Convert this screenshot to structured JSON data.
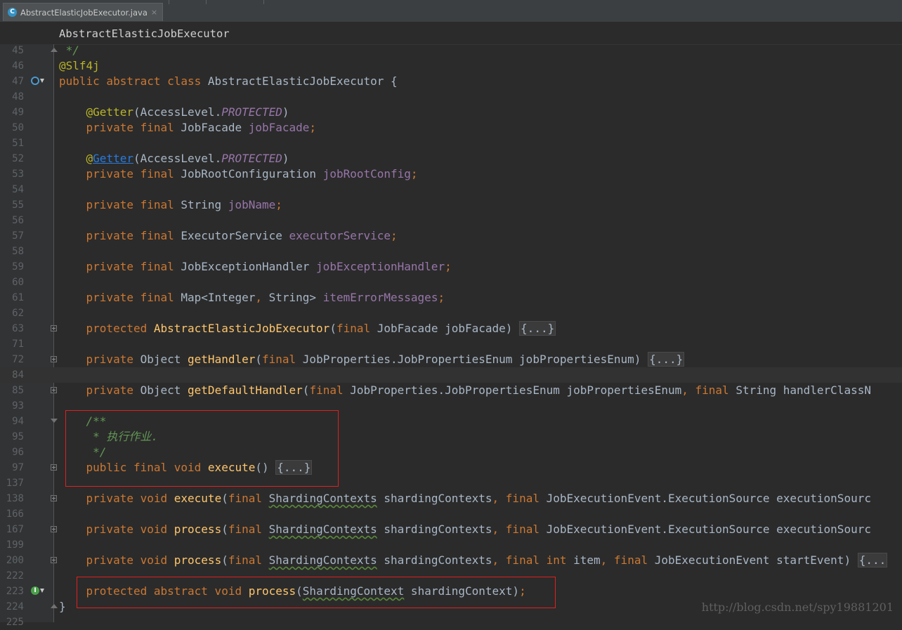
{
  "tab": {
    "icon": "C",
    "label": "AbstractElasticJobExecutor.java",
    "close": "×"
  },
  "breadcrumb": "AbstractElasticJobExecutor",
  "lines": [
    {
      "n": "45",
      "marker": "",
      "fold": "up",
      "segs": [
        {
          "t": " */",
          "c": "doc"
        }
      ]
    },
    {
      "n": "46",
      "marker": "",
      "fold": "",
      "segs": [
        {
          "t": "@Slf4j",
          "c": "ann"
        }
      ]
    },
    {
      "n": "47",
      "marker": "overridden",
      "fold": "",
      "segs": [
        {
          "t": "public abstract class ",
          "c": "kw"
        },
        {
          "t": "AbstractElasticJobExecutor {",
          "c": ""
        }
      ]
    },
    {
      "n": "48",
      "marker": "",
      "fold": "",
      "segs": []
    },
    {
      "n": "49",
      "marker": "",
      "fold": "",
      "segs": [
        {
          "t": "    @Getter",
          "c": "ann"
        },
        {
          "t": "(AccessLevel.",
          "c": ""
        },
        {
          "t": "PROTECTED",
          "c": "ital"
        },
        {
          "t": ")",
          "c": ""
        }
      ]
    },
    {
      "n": "50",
      "marker": "",
      "fold": "",
      "segs": [
        {
          "t": "    private final ",
          "c": "kw"
        },
        {
          "t": "JobFacade ",
          "c": ""
        },
        {
          "t": "jobFacade",
          "c": "fld"
        },
        {
          "t": ";",
          "c": "kw"
        }
      ]
    },
    {
      "n": "51",
      "marker": "",
      "fold": "",
      "segs": []
    },
    {
      "n": "52",
      "marker": "",
      "fold": "",
      "segs": [
        {
          "t": "    @",
          "c": "ann"
        },
        {
          "t": "Getter",
          "c": "link"
        },
        {
          "t": "(AccessLevel.",
          "c": ""
        },
        {
          "t": "PROTECTED",
          "c": "ital"
        },
        {
          "t": ")",
          "c": ""
        }
      ]
    },
    {
      "n": "53",
      "marker": "",
      "fold": "",
      "segs": [
        {
          "t": "    private final ",
          "c": "kw"
        },
        {
          "t": "JobRootConfiguration ",
          "c": ""
        },
        {
          "t": "jobRootConfig",
          "c": "fld"
        },
        {
          "t": ";",
          "c": "kw"
        }
      ]
    },
    {
      "n": "54",
      "marker": "",
      "fold": "",
      "segs": []
    },
    {
      "n": "55",
      "marker": "",
      "fold": "",
      "segs": [
        {
          "t": "    private final ",
          "c": "kw"
        },
        {
          "t": "String ",
          "c": ""
        },
        {
          "t": "jobName",
          "c": "fld"
        },
        {
          "t": ";",
          "c": "kw"
        }
      ]
    },
    {
      "n": "56",
      "marker": "",
      "fold": "",
      "segs": []
    },
    {
      "n": "57",
      "marker": "",
      "fold": "",
      "segs": [
        {
          "t": "    private final ",
          "c": "kw"
        },
        {
          "t": "ExecutorService ",
          "c": ""
        },
        {
          "t": "executorService",
          "c": "fld"
        },
        {
          "t": ";",
          "c": "kw"
        }
      ]
    },
    {
      "n": "58",
      "marker": "",
      "fold": "",
      "segs": []
    },
    {
      "n": "59",
      "marker": "",
      "fold": "",
      "segs": [
        {
          "t": "    private final ",
          "c": "kw"
        },
        {
          "t": "JobExceptionHandler ",
          "c": ""
        },
        {
          "t": "jobExceptionHandler",
          "c": "fld"
        },
        {
          "t": ";",
          "c": "kw"
        }
      ]
    },
    {
      "n": "60",
      "marker": "",
      "fold": "",
      "segs": []
    },
    {
      "n": "61",
      "marker": "",
      "fold": "",
      "segs": [
        {
          "t": "    private final ",
          "c": "kw"
        },
        {
          "t": "Map<Integer",
          "c": ""
        },
        {
          "t": ", ",
          "c": "kw"
        },
        {
          "t": "String> ",
          "c": ""
        },
        {
          "t": "itemErrorMessages",
          "c": "fld"
        },
        {
          "t": ";",
          "c": "kw"
        }
      ]
    },
    {
      "n": "62",
      "marker": "",
      "fold": "",
      "segs": []
    },
    {
      "n": "63",
      "marker": "",
      "fold": "plus",
      "segs": [
        {
          "t": "    protected ",
          "c": "kw"
        },
        {
          "t": "AbstractElasticJobExecutor",
          "c": "fn"
        },
        {
          "t": "(",
          "c": ""
        },
        {
          "t": "final ",
          "c": "kw"
        },
        {
          "t": "JobFacade jobFacade) ",
          "c": ""
        },
        {
          "t": "{...}",
          "c": "folded"
        }
      ]
    },
    {
      "n": "71",
      "marker": "",
      "fold": "",
      "segs": []
    },
    {
      "n": "72",
      "marker": "",
      "fold": "plus",
      "segs": [
        {
          "t": "    private ",
          "c": "kw"
        },
        {
          "t": "Object ",
          "c": ""
        },
        {
          "t": "getHandler",
          "c": "fn"
        },
        {
          "t": "(",
          "c": ""
        },
        {
          "t": "final ",
          "c": "kw"
        },
        {
          "t": "JobProperties.JobPropertiesEnum jobPropertiesEnum) ",
          "c": ""
        },
        {
          "t": "{...}",
          "c": "folded"
        }
      ]
    },
    {
      "n": "84",
      "marker": "",
      "fold": "",
      "hl": true,
      "segs": []
    },
    {
      "n": "85",
      "marker": "",
      "fold": "plus",
      "segs": [
        {
          "t": "    private ",
          "c": "kw"
        },
        {
          "t": "Object ",
          "c": ""
        },
        {
          "t": "getDefaultHandler",
          "c": "fn"
        },
        {
          "t": "(",
          "c": ""
        },
        {
          "t": "final ",
          "c": "kw"
        },
        {
          "t": "JobProperties.JobPropertiesEnum jobPropertiesEnum",
          "c": ""
        },
        {
          "t": ", ",
          "c": "kw"
        },
        {
          "t": "final ",
          "c": "kw"
        },
        {
          "t": "String handlerClassN",
          "c": ""
        }
      ]
    },
    {
      "n": "93",
      "marker": "",
      "fold": "",
      "segs": []
    },
    {
      "n": "94",
      "marker": "",
      "fold": "down",
      "segs": [
        {
          "t": "    /**",
          "c": "doc"
        }
      ]
    },
    {
      "n": "95",
      "marker": "",
      "fold": "",
      "segs": [
        {
          "t": "     * 执行作业.",
          "c": "doc"
        }
      ]
    },
    {
      "n": "96",
      "marker": "",
      "fold": "",
      "segs": [
        {
          "t": "     */",
          "c": "doc"
        }
      ]
    },
    {
      "n": "97",
      "marker": "",
      "fold": "plus",
      "segs": [
        {
          "t": "    public final void ",
          "c": "kw"
        },
        {
          "t": "execute",
          "c": "fn"
        },
        {
          "t": "() ",
          "c": ""
        },
        {
          "t": "{...}",
          "c": "folded"
        }
      ]
    },
    {
      "n": "137",
      "marker": "",
      "fold": "",
      "segs": []
    },
    {
      "n": "138",
      "marker": "",
      "fold": "plus",
      "segs": [
        {
          "t": "    private void ",
          "c": "kw"
        },
        {
          "t": "execute",
          "c": "fn"
        },
        {
          "t": "(",
          "c": ""
        },
        {
          "t": "final ",
          "c": "kw"
        },
        {
          "t": "ShardingContexts",
          "c": "sq"
        },
        {
          "t": " shardingContexts",
          "c": ""
        },
        {
          "t": ", ",
          "c": "kw"
        },
        {
          "t": "final ",
          "c": "kw"
        },
        {
          "t": "JobExecutionEvent.ExecutionSource executionSourc",
          "c": ""
        }
      ]
    },
    {
      "n": "166",
      "marker": "",
      "fold": "",
      "segs": []
    },
    {
      "n": "167",
      "marker": "",
      "fold": "plus",
      "segs": [
        {
          "t": "    private void ",
          "c": "kw"
        },
        {
          "t": "process",
          "c": "fn"
        },
        {
          "t": "(",
          "c": ""
        },
        {
          "t": "final ",
          "c": "kw"
        },
        {
          "t": "ShardingContexts",
          "c": "sq"
        },
        {
          "t": " shardingContexts",
          "c": ""
        },
        {
          "t": ", ",
          "c": "kw"
        },
        {
          "t": "final ",
          "c": "kw"
        },
        {
          "t": "JobExecutionEvent.ExecutionSource executionSourc",
          "c": ""
        }
      ]
    },
    {
      "n": "199",
      "marker": "",
      "fold": "",
      "segs": []
    },
    {
      "n": "200",
      "marker": "",
      "fold": "plus",
      "segs": [
        {
          "t": "    private void ",
          "c": "kw"
        },
        {
          "t": "process",
          "c": "fn"
        },
        {
          "t": "(",
          "c": ""
        },
        {
          "t": "final ",
          "c": "kw"
        },
        {
          "t": "ShardingContexts",
          "c": "sq"
        },
        {
          "t": " shardingContexts",
          "c": ""
        },
        {
          "t": ", ",
          "c": "kw"
        },
        {
          "t": "final int ",
          "c": "kw"
        },
        {
          "t": "item",
          "c": ""
        },
        {
          "t": ", ",
          "c": "kw"
        },
        {
          "t": "final ",
          "c": "kw"
        },
        {
          "t": "JobExecutionEvent startEvent) ",
          "c": ""
        },
        {
          "t": "{...",
          "c": "folded"
        }
      ]
    },
    {
      "n": "222",
      "marker": "",
      "fold": "",
      "segs": []
    },
    {
      "n": "223",
      "marker": "impl",
      "fold": "",
      "segs": [
        {
          "t": "    protected abstract void ",
          "c": "kw"
        },
        {
          "t": "process",
          "c": "fn"
        },
        {
          "t": "(",
          "c": ""
        },
        {
          "t": "ShardingContext",
          "c": "sq"
        },
        {
          "t": " shardingContext)",
          "c": ""
        },
        {
          "t": ";",
          "c": "kw"
        }
      ]
    },
    {
      "n": "224",
      "marker": "",
      "fold": "up",
      "segs": [
        {
          "t": "}",
          "c": ""
        }
      ]
    },
    {
      "n": "225",
      "marker": "",
      "fold": "",
      "segs": []
    }
  ],
  "watermark": "http://blog.csdn.net/spy19881201"
}
